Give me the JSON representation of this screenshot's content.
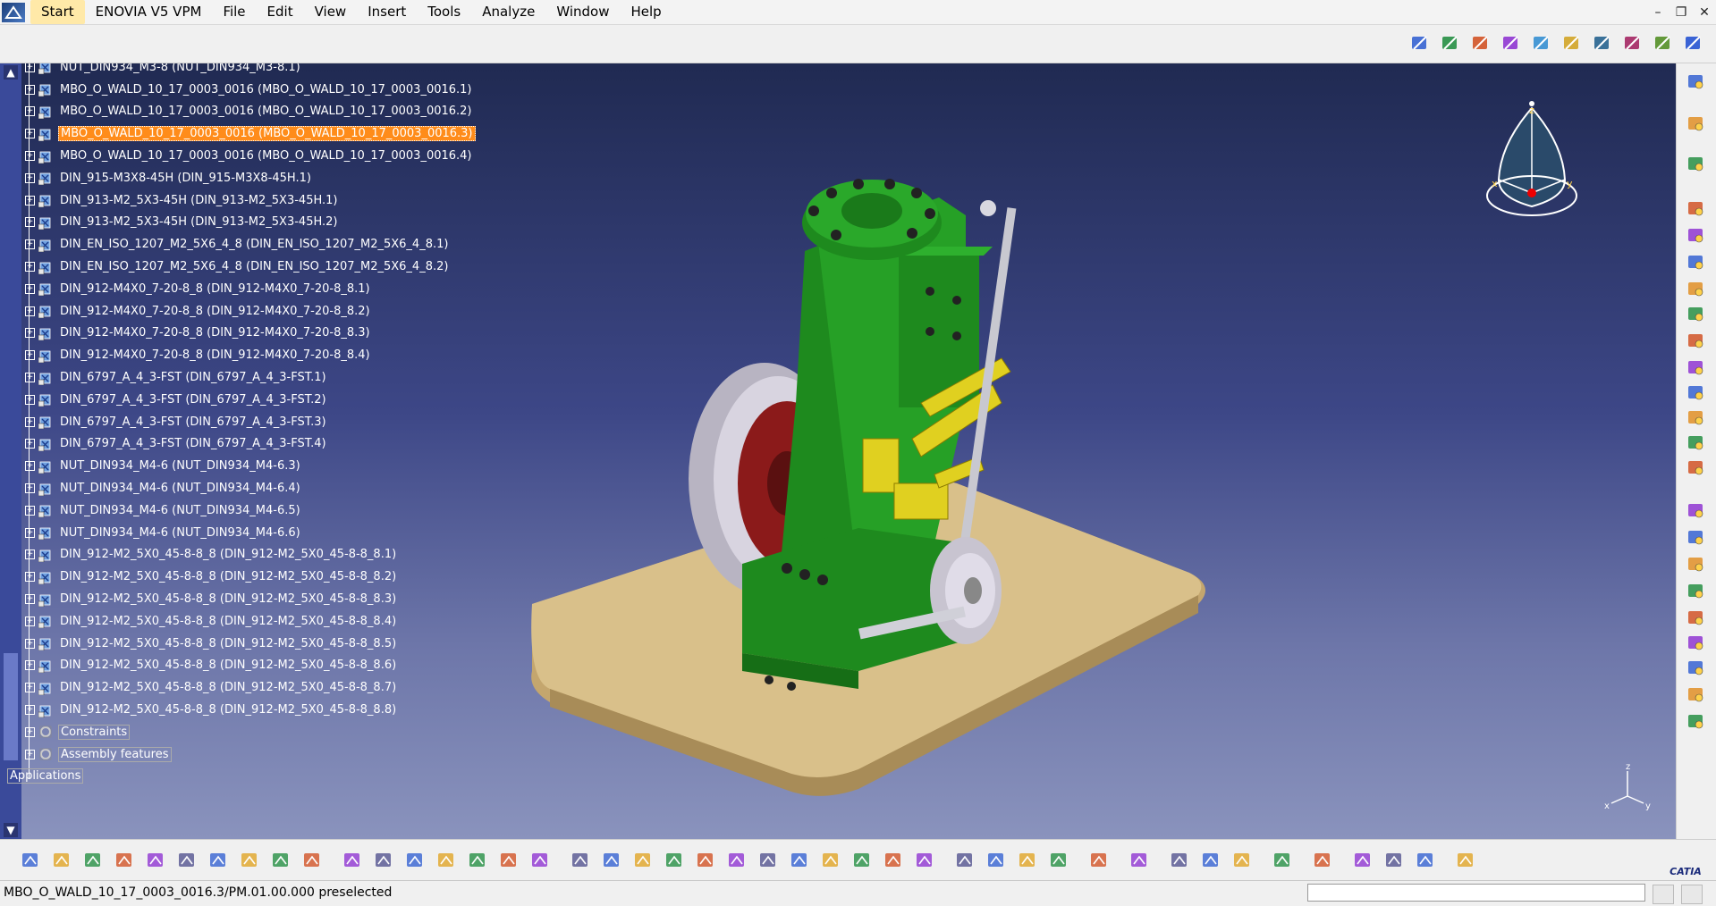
{
  "menubar": {
    "items": [
      "Start",
      "ENOVIA V5 VPM",
      "File",
      "Edit",
      "View",
      "Insert",
      "Tools",
      "Analyze",
      "Window",
      "Help"
    ]
  },
  "tree": {
    "rows": [
      {
        "label": "NUT_DIN934_M3-8 (NUT_DIN934_M3-8.1)",
        "selected": false
      },
      {
        "label": "MBO_O_WALD_10_17_0003_0016 (MBO_O_WALD_10_17_0003_0016.1)",
        "selected": false
      },
      {
        "label": "MBO_O_WALD_10_17_0003_0016 (MBO_O_WALD_10_17_0003_0016.2)",
        "selected": false
      },
      {
        "label": "MBO_O_WALD_10_17_0003_0016 (MBO_O_WALD_10_17_0003_0016.3)",
        "selected": true
      },
      {
        "label": "MBO_O_WALD_10_17_0003_0016 (MBO_O_WALD_10_17_0003_0016.4)",
        "selected": false
      },
      {
        "label": "DIN_915-M3X8-45H (DIN_915-M3X8-45H.1)",
        "selected": false
      },
      {
        "label": "DIN_913-M2_5X3-45H (DIN_913-M2_5X3-45H.1)",
        "selected": false
      },
      {
        "label": "DIN_913-M2_5X3-45H (DIN_913-M2_5X3-45H.2)",
        "selected": false
      },
      {
        "label": "DIN_EN_ISO_1207_M2_5X6_4_8 (DIN_EN_ISO_1207_M2_5X6_4_8.1)",
        "selected": false
      },
      {
        "label": "DIN_EN_ISO_1207_M2_5X6_4_8 (DIN_EN_ISO_1207_M2_5X6_4_8.2)",
        "selected": false
      },
      {
        "label": "DIN_912-M4X0_7-20-8_8 (DIN_912-M4X0_7-20-8_8.1)",
        "selected": false
      },
      {
        "label": "DIN_912-M4X0_7-20-8_8 (DIN_912-M4X0_7-20-8_8.2)",
        "selected": false
      },
      {
        "label": "DIN_912-M4X0_7-20-8_8 (DIN_912-M4X0_7-20-8_8.3)",
        "selected": false
      },
      {
        "label": "DIN_912-M4X0_7-20-8_8 (DIN_912-M4X0_7-20-8_8.4)",
        "selected": false
      },
      {
        "label": "DIN_6797_A_4_3-FST (DIN_6797_A_4_3-FST.1)",
        "selected": false
      },
      {
        "label": "DIN_6797_A_4_3-FST (DIN_6797_A_4_3-FST.2)",
        "selected": false
      },
      {
        "label": "DIN_6797_A_4_3-FST (DIN_6797_A_4_3-FST.3)",
        "selected": false
      },
      {
        "label": "DIN_6797_A_4_3-FST (DIN_6797_A_4_3-FST.4)",
        "selected": false
      },
      {
        "label": "NUT_DIN934_M4-6 (NUT_DIN934_M4-6.3)",
        "selected": false
      },
      {
        "label": "NUT_DIN934_M4-6 (NUT_DIN934_M4-6.4)",
        "selected": false
      },
      {
        "label": "NUT_DIN934_M4-6 (NUT_DIN934_M4-6.5)",
        "selected": false
      },
      {
        "label": "NUT_DIN934_M4-6 (NUT_DIN934_M4-6.6)",
        "selected": false
      },
      {
        "label": "DIN_912-M2_5X0_45-8-8_8 (DIN_912-M2_5X0_45-8-8_8.1)",
        "selected": false
      },
      {
        "label": "DIN_912-M2_5X0_45-8-8_8 (DIN_912-M2_5X0_45-8-8_8.2)",
        "selected": false
      },
      {
        "label": "DIN_912-M2_5X0_45-8-8_8 (DIN_912-M2_5X0_45-8-8_8.3)",
        "selected": false
      },
      {
        "label": "DIN_912-M2_5X0_45-8-8_8 (DIN_912-M2_5X0_45-8-8_8.4)",
        "selected": false
      },
      {
        "label": "DIN_912-M2_5X0_45-8-8_8 (DIN_912-M2_5X0_45-8-8_8.5)",
        "selected": false
      },
      {
        "label": "DIN_912-M2_5X0_45-8-8_8 (DIN_912-M2_5X0_45-8-8_8.6)",
        "selected": false
      },
      {
        "label": "DIN_912-M2_5X0_45-8-8_8 (DIN_912-M2_5X0_45-8-8_8.7)",
        "selected": false
      },
      {
        "label": "DIN_912-M2_5X0_45-8-8_8 (DIN_912-M2_5X0_45-8-8_8.8)",
        "selected": false
      }
    ],
    "constraints": "Constraints",
    "assembly_features": "Assembly features",
    "applications": "Applications"
  },
  "compass_labels": {
    "z": "z",
    "x": "x",
    "y": "y"
  },
  "axis_labels": {
    "z": "z",
    "x": "x",
    "y": "y"
  },
  "catia": "CATIA",
  "status": {
    "message": "MBO_O_WALD_10_17_0003_0016.3/PM.01.00.000 preselected",
    "power_input": ""
  },
  "colors": {
    "selection": "#ff8c1a",
    "engine_body": "#1e8a1e",
    "brass": "#e0d020",
    "base_plate": "#d9c08a",
    "flywheel_rim": "#c8c4d0",
    "flywheel_hub": "#8b1a1a"
  }
}
